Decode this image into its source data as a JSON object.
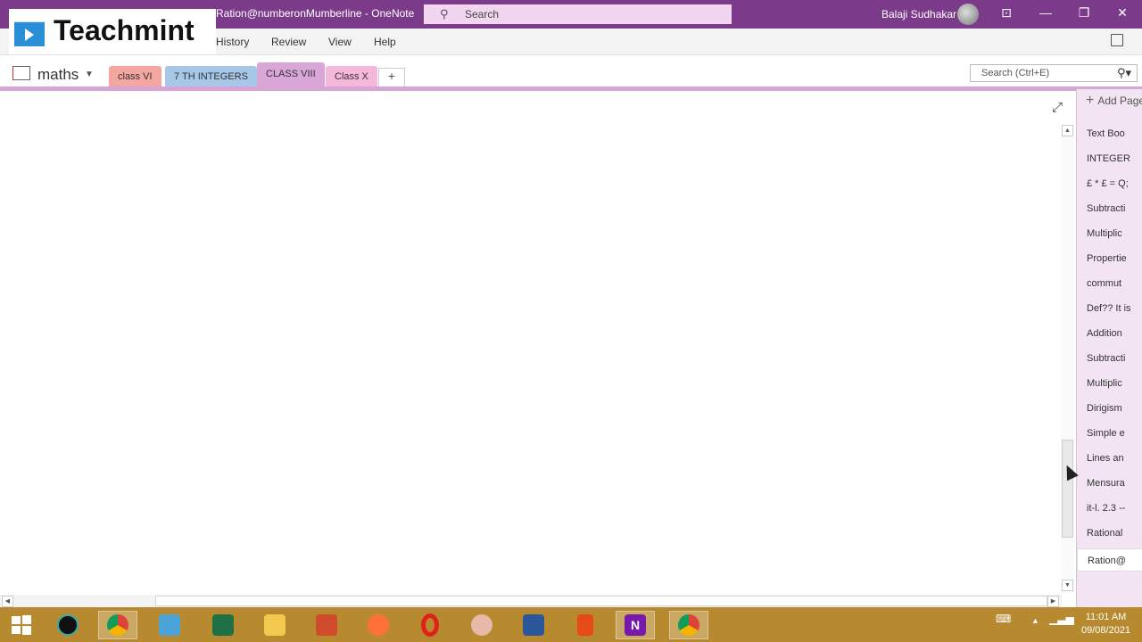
{
  "window": {
    "title": "Ration@numberonMumberline  -  OneNote",
    "search_placeholder": "Search",
    "user_name": "Balaji Sudhakar",
    "controls": [
      "restore-ribbon",
      "minimize",
      "maximize",
      "close"
    ]
  },
  "ribbon": {
    "menus": [
      "History",
      "Review",
      "View",
      "Help"
    ]
  },
  "notebook": {
    "name": "maths",
    "sections": [
      {
        "label": "class VI",
        "color": "#f4a6a0"
      },
      {
        "label": "7 TH INTEGERS",
        "color": "#a7c7e8"
      },
      {
        "label": "CLASS VIII",
        "color": "#d9a6d8",
        "active": true
      },
      {
        "label": "Class X",
        "color": "#f6b8d8"
      }
    ],
    "add_section_label": "+",
    "search_placeholder": "Search (Ctrl+E)"
  },
  "pages_panel": {
    "add_page_label": "Add Page",
    "pages": [
      "Text Boo",
      "INTEGER",
      "£ * £ = Q;",
      "Subtracti",
      "Multiplic",
      "Propertie",
      "commut",
      "Def?? It is",
      "Addition",
      "Subtracti",
      "Multiplic",
      "Dirigism",
      "Simple e",
      "Lines an",
      "Mensura",
      "it-l. 2.3 --",
      "Rational",
      "Ration@"
    ],
    "current_page_index": 17
  },
  "taskbar": {
    "apps": [
      "windows-start",
      "pen-app",
      "chrome",
      "media-player",
      "excel",
      "file-explorer",
      "powerpoint",
      "firefox",
      "opera",
      "snipping-tool",
      "word",
      "office",
      "onenote",
      "chrome-profile"
    ],
    "time": "11:01 AM",
    "date": "09/08/2021"
  },
  "watermark": {
    "brand": "Teachmint"
  },
  "colors": {
    "titlebar": "#7b3a8a",
    "accent_line": "#d7a5d6",
    "pages_panel": "#f2e4f2",
    "taskbar": "#b88a2f"
  }
}
